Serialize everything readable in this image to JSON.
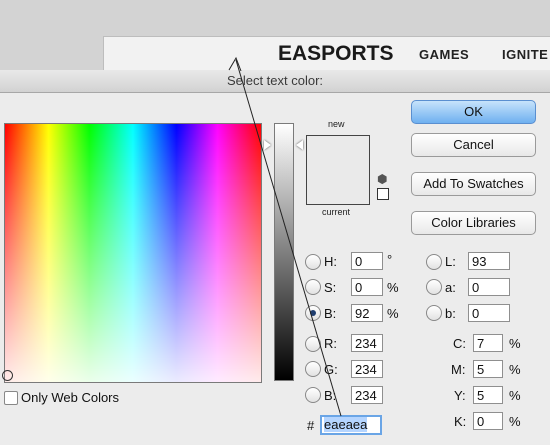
{
  "website": {
    "logo": "EASPORTS",
    "nav": [
      "GAMES",
      "IGNITE"
    ]
  },
  "dialog": {
    "title": "Select text color:",
    "swatch": {
      "new_label": "new",
      "current_label": "current",
      "color": "#eaeaea"
    },
    "buttons": {
      "ok": "OK",
      "cancel": "Cancel",
      "add_to_swatches": "Add To Swatches",
      "color_libraries": "Color Libraries"
    },
    "hsb": {
      "h": {
        "label": "H:",
        "value": "0",
        "unit": "°"
      },
      "s": {
        "label": "S:",
        "value": "0",
        "unit": "%"
      },
      "b": {
        "label": "B:",
        "value": "92",
        "unit": "%",
        "selected": true
      }
    },
    "rgb": {
      "r": {
        "label": "R:",
        "value": "234"
      },
      "g": {
        "label": "G:",
        "value": "234"
      },
      "b": {
        "label": "B:",
        "value": "234"
      }
    },
    "lab": {
      "l": {
        "label": "L:",
        "value": "93"
      },
      "a": {
        "label": "a:",
        "value": "0"
      },
      "b": {
        "label": "b:",
        "value": "0"
      }
    },
    "cmyk": {
      "c": {
        "label": "C:",
        "value": "7",
        "unit": "%"
      },
      "m": {
        "label": "M:",
        "value": "5",
        "unit": "%"
      },
      "y": {
        "label": "Y:",
        "value": "5",
        "unit": "%"
      },
      "k": {
        "label": "K:",
        "value": "0",
        "unit": "%"
      }
    },
    "hex": {
      "label": "#",
      "value": "eaeaea"
    },
    "only_web_colors": {
      "label": "Only Web Colors",
      "checked": false
    }
  }
}
